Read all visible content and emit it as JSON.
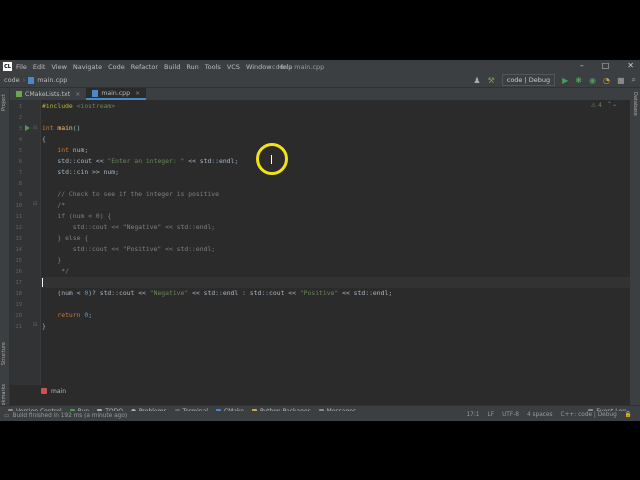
{
  "window": {
    "title": "code - main.cpp",
    "app_icon": "CL",
    "menu": [
      "File",
      "Edit",
      "View",
      "Navigate",
      "Code",
      "Refactor",
      "Build",
      "Run",
      "Tools",
      "VCS",
      "Window",
      "Help"
    ],
    "controls": {
      "minimize": "–",
      "maximize": "□",
      "close": "✕"
    }
  },
  "navbar": {
    "project": "code",
    "file": "main.cpp",
    "run_config": "code | Debug"
  },
  "left_strip": {
    "project": "Project",
    "structure": "Structure",
    "bookmarks": "Bookmarks"
  },
  "right_strip": {
    "database": "Database"
  },
  "tabs": [
    {
      "label": "CMakeLists.txt",
      "close": "×"
    },
    {
      "label": "main.cpp",
      "close": "×"
    }
  ],
  "editor": {
    "warnings_count": "4",
    "line_numbers": [
      "1",
      "2",
      "3",
      "4",
      "5",
      "6",
      "7",
      "8",
      "9",
      "10",
      "11",
      "12",
      "13",
      "14",
      "15",
      "16",
      "17",
      "18",
      "19",
      "20",
      "21"
    ],
    "lines": [
      {
        "parts": [
          {
            "t": "#include ",
            "c": "pp"
          },
          {
            "t": "<iostream>",
            "c": "inc"
          }
        ]
      },
      {
        "parts": []
      },
      {
        "parts": [
          {
            "t": "int ",
            "c": "kw"
          },
          {
            "t": "main",
            "c": "fn"
          },
          {
            "t": "()",
            "c": ""
          }
        ]
      },
      {
        "parts": [
          {
            "t": "{",
            "c": ""
          }
        ]
      },
      {
        "parts": [
          {
            "t": "    int ",
            "c": "kw"
          },
          {
            "t": "num;",
            "c": ""
          }
        ]
      },
      {
        "parts": [
          {
            "t": "    std::cout << ",
            "c": ""
          },
          {
            "t": "\"Enter an integer: \"",
            "c": "str"
          },
          {
            "t": " << std::endl;",
            "c": ""
          }
        ]
      },
      {
        "parts": [
          {
            "t": "    std::cin >> num;",
            "c": ""
          }
        ]
      },
      {
        "parts": []
      },
      {
        "parts": [
          {
            "t": "    // Check to see if the integer is positive",
            "c": "cmt"
          }
        ]
      },
      {
        "parts": [
          {
            "t": "    /*",
            "c": "cmt"
          }
        ]
      },
      {
        "parts": [
          {
            "t": "    if (num < 0) {",
            "c": "cmt"
          }
        ]
      },
      {
        "parts": [
          {
            "t": "        std::cout << \"Negative\" << std::endl;",
            "c": "cmt"
          }
        ]
      },
      {
        "parts": [
          {
            "t": "    } else {",
            "c": "cmt"
          }
        ]
      },
      {
        "parts": [
          {
            "t": "        std::cout << \"Positive\" << std::endl;",
            "c": "cmt"
          }
        ]
      },
      {
        "parts": [
          {
            "t": "    }",
            "c": "cmt"
          }
        ]
      },
      {
        "parts": [
          {
            "t": "     */",
            "c": "cmt"
          }
        ]
      },
      {
        "parts": []
      },
      {
        "parts": [
          {
            "t": "    (num < ",
            "c": ""
          },
          {
            "t": "0",
            "c": "num"
          },
          {
            "t": ")? std::cout << ",
            "c": ""
          },
          {
            "t": "\"Negative\"",
            "c": "str"
          },
          {
            "t": " << std::endl : std::cout << ",
            "c": ""
          },
          {
            "t": "\"Positive\"",
            "c": "str"
          },
          {
            "t": " << std::endl;",
            "c": ""
          }
        ]
      },
      {
        "parts": []
      },
      {
        "parts": [
          {
            "t": "    return ",
            "c": "kw"
          },
          {
            "t": "0",
            "c": "num"
          },
          {
            "t": ";",
            "c": ""
          }
        ]
      },
      {
        "parts": [
          {
            "t": "}",
            "c": ""
          }
        ]
      }
    ],
    "breadcrumb_function": "main"
  },
  "tool_windows": [
    "Version Control",
    "Run",
    "TODO",
    "Problems",
    "Terminal",
    "CMake",
    "Python Packages",
    "Messages"
  ],
  "event_log": "Event Log",
  "status": {
    "message": "Build finished in 192 ms (a minute ago)",
    "position": "17:1",
    "line_sep": "LF",
    "encoding": "UTF-8",
    "indent": "4 spaces",
    "context": "C++: code | Debug"
  },
  "colors": {
    "accent": "#4a88c7",
    "run_green": "#499c54",
    "cursor_highlight": "#f2e020"
  }
}
